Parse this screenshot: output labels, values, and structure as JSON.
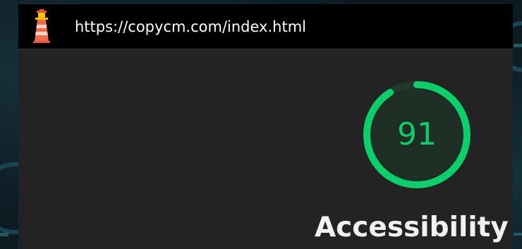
{
  "window": {
    "url": "https://copycm.com/index.html",
    "icon": "lighthouse-icon"
  },
  "report": {
    "category": {
      "score": "91",
      "score_value": 91,
      "title": "Accessibility",
      "rating_color": "#0cce6b"
    }
  },
  "colors": {
    "window_bg": "#232323",
    "titlebar_bg": "#000000",
    "gauge_pass": "#0cce6b",
    "gauge_track": "#1f3a2a"
  }
}
